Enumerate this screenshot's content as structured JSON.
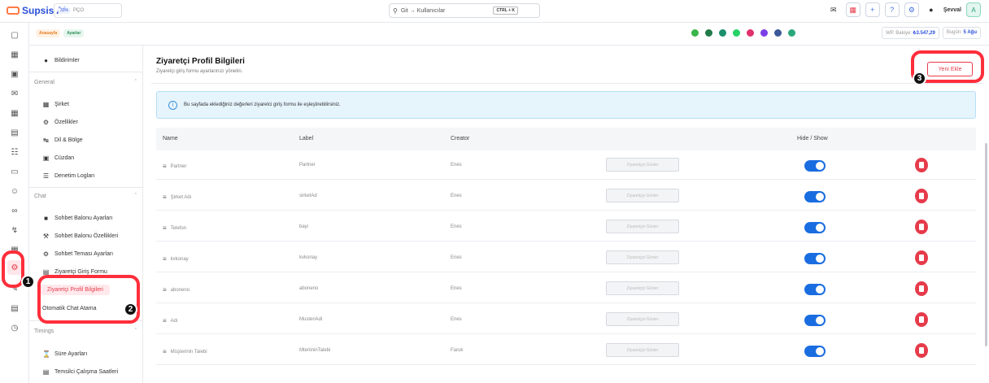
{
  "topbar": {
    "brand": "Supsis AI",
    "plan_pct": "33%",
    "plan_label": "PÇO",
    "search_placeholder": "Git → Kullanıcılar",
    "search_shortcut": "CTRL + K",
    "username": "Şevval",
    "avatar_letter": "A"
  },
  "breadcrumbs": [
    "Anasayfa",
    "Ayarlar"
  ],
  "stats": {
    "balance_label": "WP. Bakiye:",
    "balance_value": "₺3.547,29",
    "today_label": "Bugün:",
    "today_value": "5 Ağu"
  },
  "sidenav": {
    "top_item": "Bildirimler",
    "general_label": "General",
    "general_items": [
      "Şirket",
      "Özellikler",
      "Dil & Bölge",
      "Cüzdan",
      "Denetim Logları"
    ],
    "chat_label": "Chat",
    "chat_items": [
      "Sohbet Balonu Ayarları",
      "Sohbet Balonu Özellikleri",
      "Sohbet Teması Ayarları",
      "Ziyaretçi Giriş Formu",
      "Ziyaretçi Profil Bilgileri",
      "Otomatik Chat Atama"
    ],
    "timings_label": "Timings",
    "timings_items": [
      "Süre Ayarları",
      "Temsilci Çalışma Saatleri"
    ]
  },
  "main": {
    "title": "Ziyaretçi Profil Bilgileri",
    "subtitle": "Ziyaretçi giriş formu ayarlarınızı yönetin.",
    "new_button": "Yeni Ekle",
    "info_text": "Bu sayfada eklediğiniz değerleri ziyaretci giriş formu ile eşleştirebilirsiniz.",
    "columns": {
      "name": "Name",
      "label": "Label",
      "creator": "Creator",
      "hide_show": "Hide / Show"
    },
    "show_button": "Ziyaretçiyi Göster",
    "rows": [
      {
        "name": "Partner",
        "label": "Partner",
        "creator": "Enes"
      },
      {
        "name": "Şirket Adı",
        "label": "sirketAd",
        "creator": "Enes"
      },
      {
        "name": "Telefon",
        "label": "bayi",
        "creator": "Enes"
      },
      {
        "name": "kvkonay",
        "label": "kvkonay",
        "creator": "Enes"
      },
      {
        "name": "aboneno",
        "label": "aboneno",
        "creator": "Enes"
      },
      {
        "name": "Adı",
        "label": "MusteriAdi",
        "creator": "Enes"
      },
      {
        "name": "Müşterinin Talebi",
        "label": "MteriininTalebi",
        "creator": "Faruk"
      }
    ]
  },
  "annotations": [
    "1",
    "2",
    "3"
  ],
  "colors": {
    "accent": "#e63b4b",
    "brand": "#2a4fd8",
    "toggle": "#1a6de0",
    "info_bg": "#e6f4fc"
  }
}
